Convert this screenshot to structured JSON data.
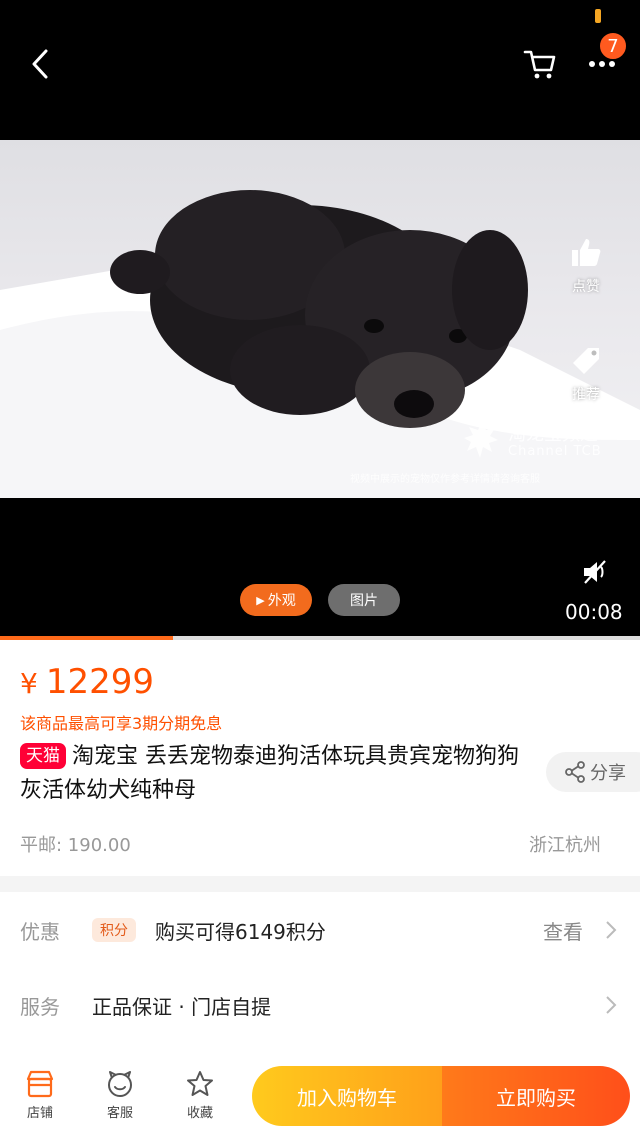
{
  "colors": {
    "accent": "#ff5000",
    "tmall_red": "#ff0036",
    "status_pill": "#f5a623",
    "cart_button": "#ffb41b",
    "buy_button": "#ff5a1a"
  },
  "header": {
    "back_icon": "chevron-left-icon",
    "cart_icon": "shopping-cart-icon",
    "more_icon": "more-dots-icon",
    "badge_count": "7"
  },
  "media": {
    "like_label": "点赞",
    "recommend_label": "推荐",
    "watermark_title": "淘宠宝频道",
    "watermark_sub": "Channel TCB",
    "disclaimer": "视频中展示的宠物仅作参考详情请咨询客服",
    "tab_appearance": "外观",
    "tab_photos": "图片",
    "time": "00:08",
    "progress": 0.27
  },
  "product": {
    "currency": "¥",
    "price": "12299",
    "installment_note": "该商品最高可享3期分期免息",
    "tmall_badge": "天猫",
    "title": "淘宠宝 丢丢宠物泰迪狗活体玩具贵宾宠物狗狗灰活体幼犬纯种母",
    "share_label": "分享",
    "shipping": "平邮: 190.00",
    "location": "浙江杭州"
  },
  "promo": {
    "label": "优惠",
    "tag": "积分",
    "text": "购买可得6149积分",
    "link": "查看"
  },
  "service": {
    "label": "服务",
    "text": "正品保证 · 门店自提"
  },
  "bottom": {
    "store_label": "店铺",
    "service_label": "客服",
    "fav_label": "收藏",
    "add_to_cart": "加入购物车",
    "buy_now": "立即购买"
  }
}
